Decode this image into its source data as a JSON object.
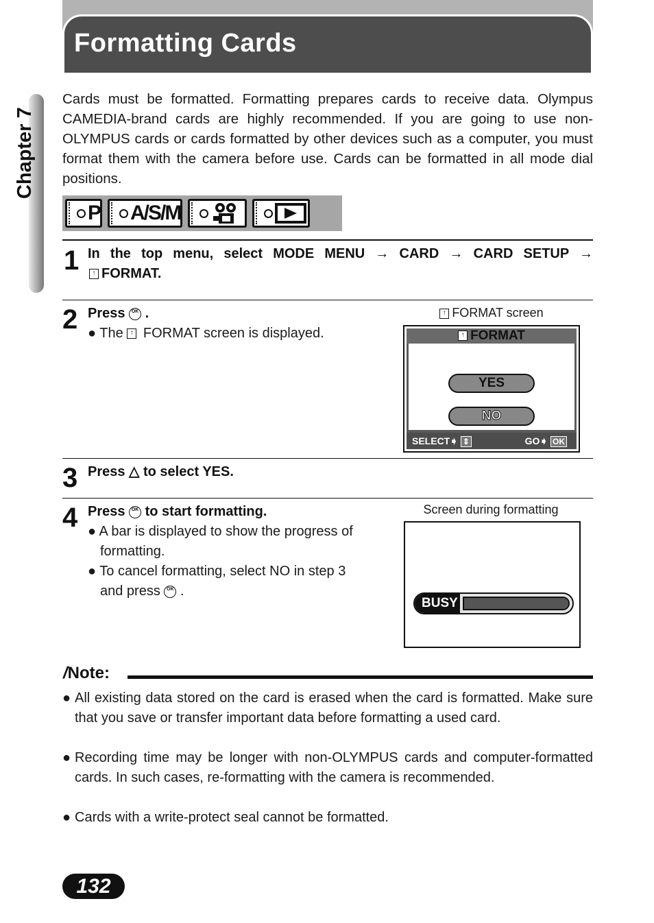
{
  "header": {
    "title": "Formatting Cards"
  },
  "chapter_tab": {
    "label": "Chapter 7"
  },
  "intro": "Cards must be formatted. Formatting prepares cards to receive data. Olympus CAMEDIA-brand cards are highly recommended. If you are going to use non-OLYMPUS cards or cards formatted by other devices such as a computer, you must format them with the camera before use. Cards can be formatted in all mode dial positions.",
  "mode_dial_positions": [
    {
      "label": "P",
      "icon": "program-mode-icon"
    },
    {
      "label": "A/S/M",
      "icon": "asm-mode-icon"
    },
    {
      "label": "",
      "icon": "movie-camera-icon"
    },
    {
      "label": "▶",
      "icon": "playback-icon"
    }
  ],
  "steps": [
    {
      "number": "1",
      "text": "In the top menu, select MODE MENU → CARD → CARD SETUP →",
      "text2": "FORMAT."
    },
    {
      "number": "2",
      "head_pre": "Press",
      "head_post": ".",
      "bullets": [
        {
          "pre": "The",
          "post": "FORMAT screen is displayed."
        }
      ]
    },
    {
      "number": "3",
      "head": "Press △ to select YES."
    },
    {
      "number": "4",
      "head_pre": "Press",
      "head_post": "to start formatting.",
      "bullets": [
        {
          "line1": "A bar is displayed to show the progress of",
          "line2": "formatting."
        },
        {
          "line1": "To cancel formatting, select NO in step 3",
          "line2_pre": "and press",
          "line2_post": "."
        }
      ]
    }
  ],
  "format_screen": {
    "caption": "FORMAT screen",
    "title": "FORMAT",
    "options": [
      "YES",
      "NO"
    ],
    "footer_left": "SELECT",
    "footer_right": "GO",
    "ok_label": "OK",
    "card_icon_glyph": "↑",
    "ok_icon_text": "OK"
  },
  "formatting_screen": {
    "caption": "Screen during formatting",
    "busy_label": "BUSY",
    "progress_fraction": 1.0
  },
  "note": {
    "title": "Note:",
    "items": [
      "All existing data stored on the card is erased when the card is formatted. Make sure that you save or transfer important data before formatting a used card.",
      "Recording time may be longer with non-OLYMPUS cards and computer-formatted cards. In such cases, re-formatting with the camera is recommended.",
      "Cards with a write-protect seal cannot be formatted."
    ]
  },
  "page_number": "132"
}
